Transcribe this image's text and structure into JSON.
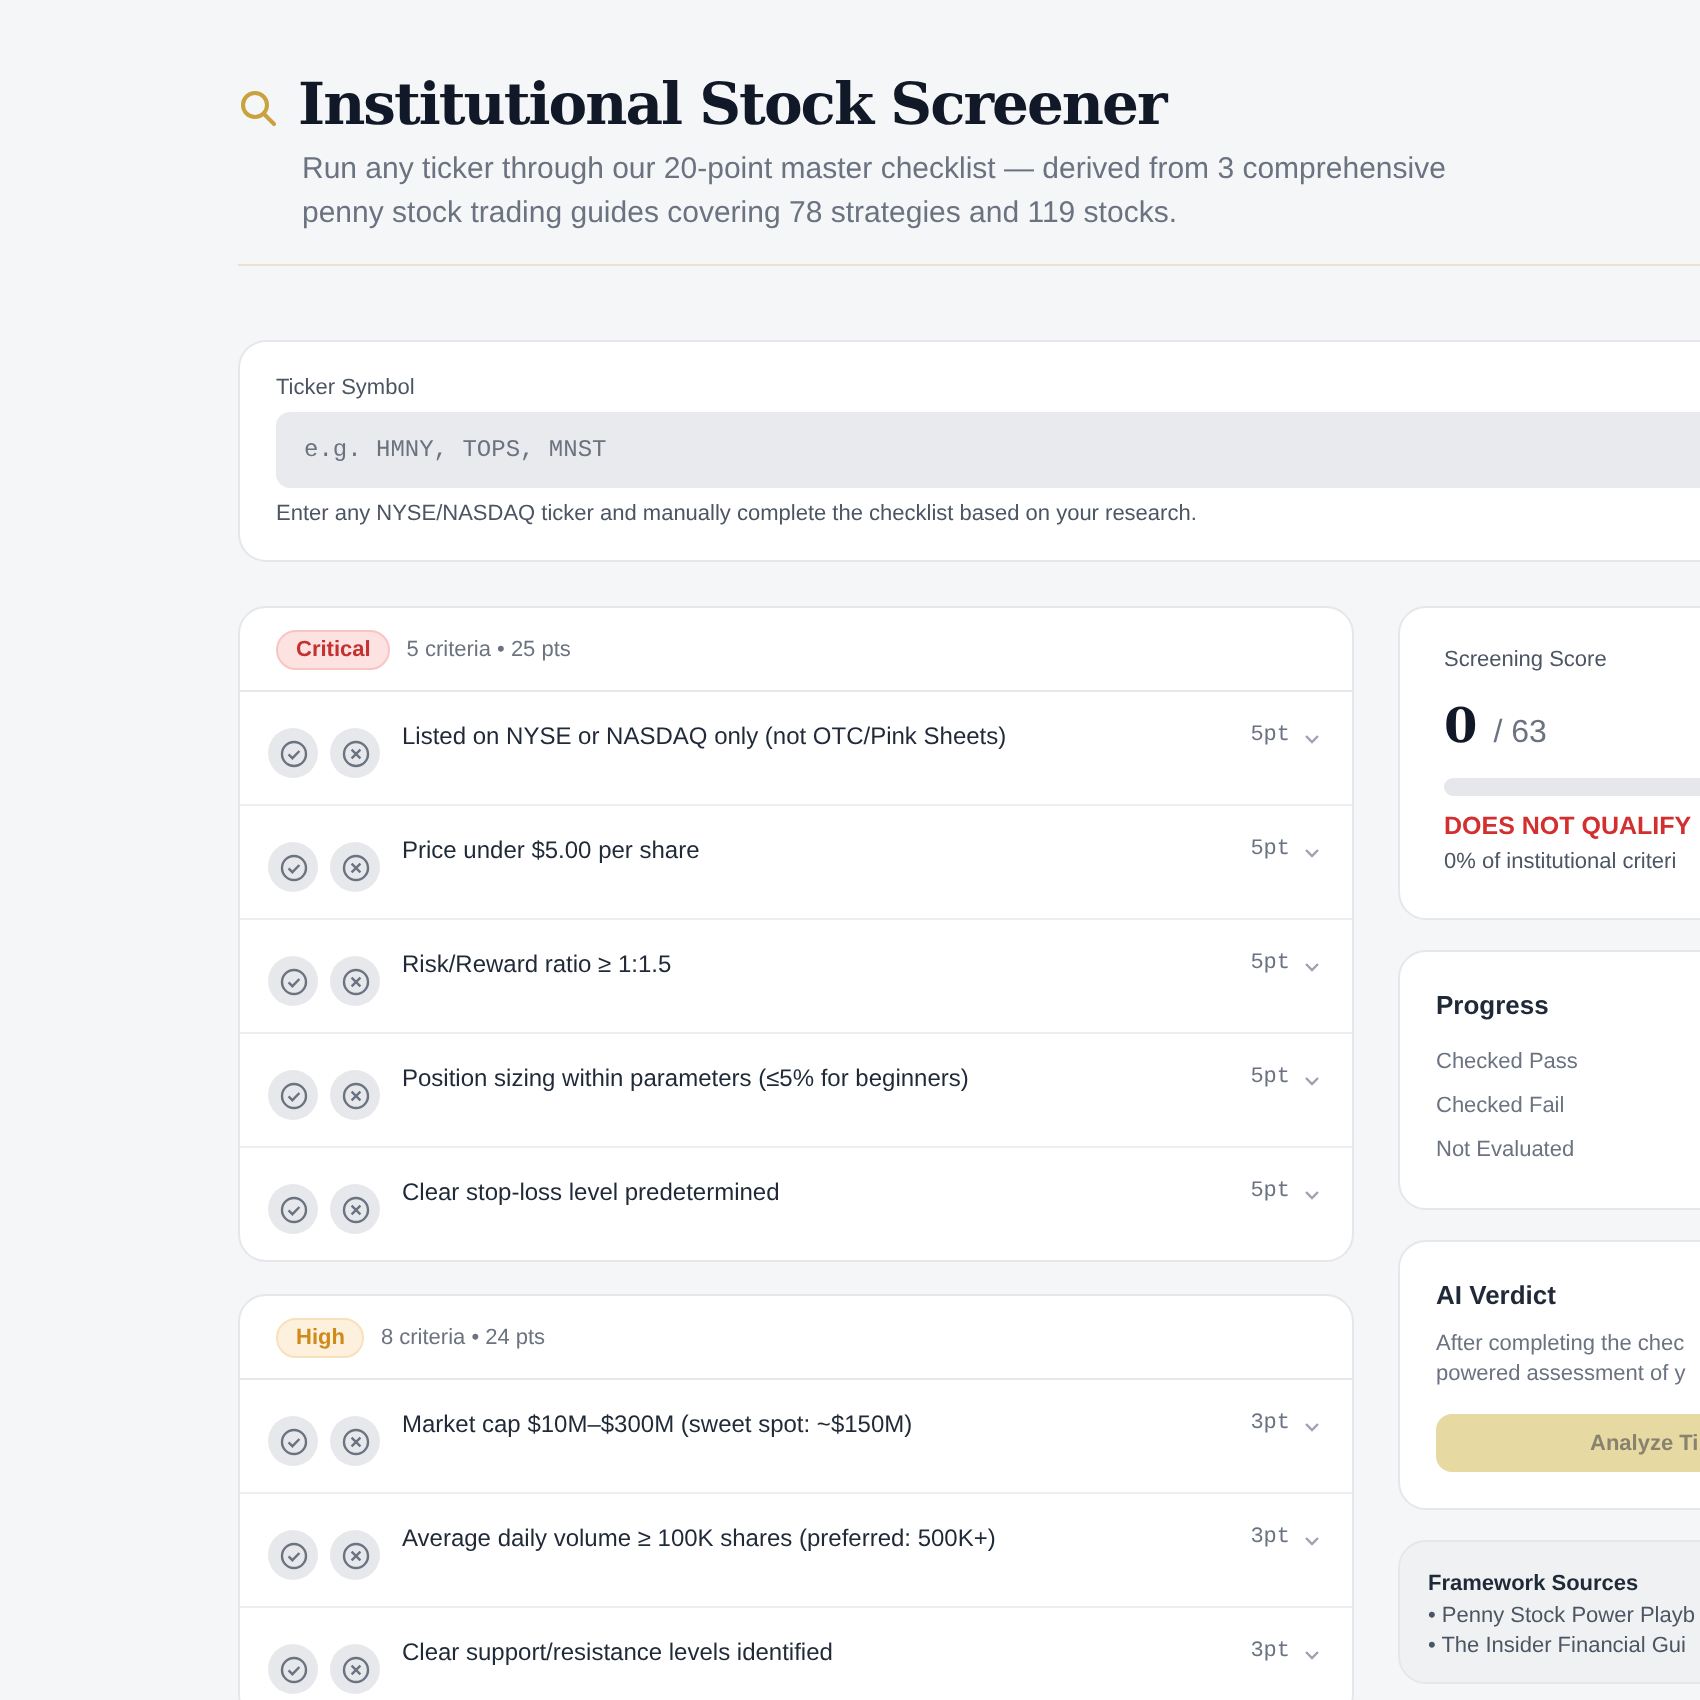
{
  "header": {
    "title": "Institutional Stock Screener",
    "subtitle": "Run any ticker through our 20-point master checklist — derived from 3 comprehensive penny stock trading guides covering 78 strategies and 119 stocks."
  },
  "ticker": {
    "label": "Ticker Symbol",
    "placeholder": "e.g. HMNY, TOPS, MNST",
    "hint": "Enter any NYSE/NASDAQ ticker and manually complete the checklist based on your research."
  },
  "groups": [
    {
      "kind": "critical",
      "badge": "Critical",
      "summary": "5 criteria • 25 pts",
      "items": [
        {
          "text": "Listed on NYSE or NASDAQ only (not OTC/Pink Sheets)",
          "points": "5pt"
        },
        {
          "text": "Price under $5.00 per share",
          "points": "5pt"
        },
        {
          "text": "Risk/Reward ratio ≥ 1:1.5",
          "points": "5pt"
        },
        {
          "text": "Position sizing within parameters (≤5% for beginners)",
          "points": "5pt"
        },
        {
          "text": "Clear stop-loss level predetermined",
          "points": "5pt"
        }
      ]
    },
    {
      "kind": "high",
      "badge": "High",
      "summary": "8 criteria • 24 pts",
      "items": [
        {
          "text": "Market cap $10M–$300M (sweet spot: ~$150M)",
          "points": "3pt"
        },
        {
          "text": "Average daily volume ≥ 100K shares (preferred: 500K+)",
          "points": "3pt"
        },
        {
          "text": "Clear support/resistance levels identified",
          "points": "3pt"
        }
      ]
    }
  ],
  "score": {
    "label": "Screening Score",
    "value": "0",
    "total": "/ 63",
    "level": 0,
    "verdict": "DOES NOT QUALIFY",
    "note": "0% of institutional criteri"
  },
  "progress": {
    "title": "Progress",
    "rows": [
      "Checked Pass",
      "Checked Fail",
      "Not Evaluated"
    ]
  },
  "ai_verdict": {
    "title": "AI Verdict",
    "text": "After completing the chec powered assessment of y",
    "button": "Analyze Ti"
  },
  "sources": {
    "title": "Framework Sources",
    "items": [
      "• Penny Stock Power Playb",
      "• The Insider Financial Gui"
    ]
  }
}
